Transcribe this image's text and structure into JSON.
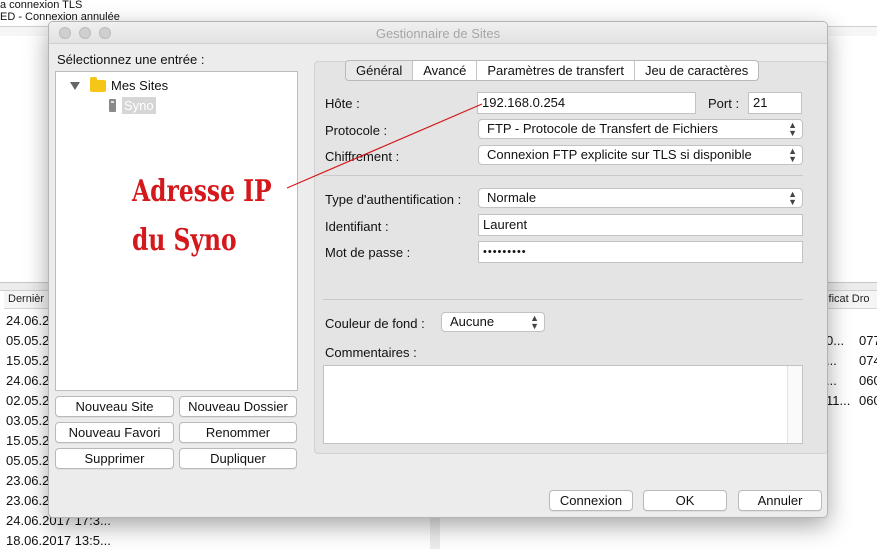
{
  "background": {
    "log_lines": [
      "a connexion TLS",
      "ED - Connexion annulée"
    ],
    "left_pane": {
      "header": "Dernièr",
      "dates": [
        "24.06.2",
        "05.05.2",
        "15.05.2",
        "24.06.2",
        "02.05.2",
        "03.05.2",
        "15.05.2",
        "05.05.2",
        "23.06.2",
        "23.06.2",
        "24.06.2017 17:3...",
        "18.06.2017 13:5..."
      ]
    },
    "right_pane": {
      "header": "dificat Dro",
      "col1": [
        "0...",
        "...",
        "...",
        "11..."
      ],
      "col2": [
        "077",
        "074",
        "060",
        "060"
      ]
    }
  },
  "dialog": {
    "title": "Gestionnaire de Sites",
    "select_label": "Sélectionnez une entrée :",
    "tree": {
      "folder": "Mes Sites",
      "site": "Syno"
    },
    "buttons_left": {
      "new_site": "Nouveau Site",
      "new_folder": "Nouveau Dossier",
      "new_bookmark": "Nouveau Favori",
      "rename": "Renommer",
      "delete": "Supprimer",
      "duplicate": "Dupliquer"
    },
    "tabs": [
      "Général",
      "Avancé",
      "Paramètres de transfert",
      "Jeu de caractères"
    ],
    "form": {
      "host_label": "Hôte :",
      "host_value": "192.168.0.254",
      "port_label": "Port :",
      "port_value": "21",
      "protocol_label": "Protocole :",
      "protocol_value": "FTP - Protocole de Transfert de Fichiers",
      "encryption_label": "Chiffrement :",
      "encryption_value": "Connexion FTP explicite sur TLS si disponible",
      "auth_label": "Type d'authentification :",
      "auth_value": "Normale",
      "user_label": "Identifiant :",
      "user_value": "Laurent",
      "password_label": "Mot de passe :",
      "password_value": "•••••••••",
      "bgcolor_label": "Couleur de fond :",
      "bgcolor_value": "Aucune",
      "comments_label": "Commentaires :"
    },
    "buttons_bottom": {
      "connect": "Connexion",
      "ok": "OK",
      "cancel": "Annuler"
    }
  },
  "annotation": {
    "line1": "Adresse IP",
    "line2": "du Syno",
    "color": "#d4181b"
  }
}
